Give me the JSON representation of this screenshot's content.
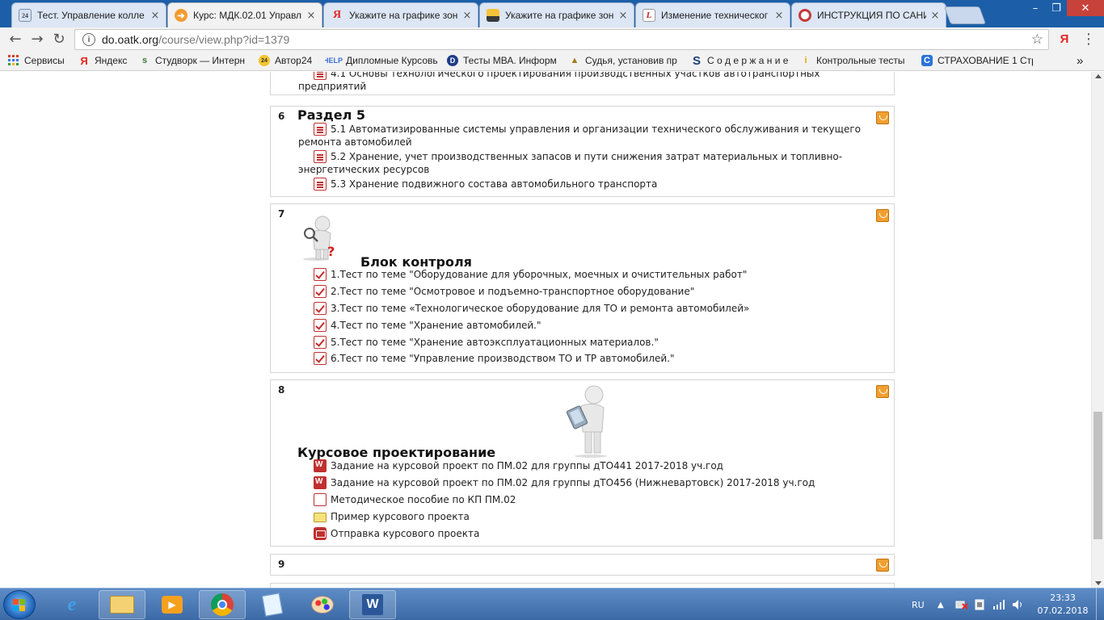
{
  "tabs": [
    {
      "title": "Тест. Управление колле",
      "favicon": "clock-badge-icon",
      "active": false
    },
    {
      "title": "Курс: МДК.02.01 Управл",
      "favicon": "moodle-icon",
      "active": true
    },
    {
      "title": "Укажите на графике зон",
      "favicon": "yandex-icon",
      "active": false
    },
    {
      "title": "Укажите на графике зон",
      "favicon": "image-icon",
      "active": false
    },
    {
      "title": "Изменение техническог",
      "favicon": "l-letter-icon",
      "active": false
    },
    {
      "title": "ИНСТРУКЦИЯ ПО САНИ",
      "favicon": "lifebuoy-icon",
      "active": false
    }
  ],
  "close_glyph": "×",
  "window": {
    "minimize": "–",
    "maximize": "❐",
    "close": "✕"
  },
  "address": {
    "host": "do.oatk.org",
    "path": "/course/view.php?id=1379"
  },
  "toolbar": {
    "back": "←",
    "forward": "→",
    "reload": "↻",
    "info": "i",
    "star": "☆",
    "yandex": "Я",
    "menu": "⋮"
  },
  "bookmarks": [
    {
      "label": "Сервисы",
      "icon": "apps-grid-icon"
    },
    {
      "label": "Яндекс",
      "icon": "yandex-icon"
    },
    {
      "label": "Студворк — Интерн",
      "icon": "studwork-icon"
    },
    {
      "label": "Автор24",
      "icon": "author24-icon"
    },
    {
      "label": "Дипломные Курсовь",
      "icon": "help-icon"
    },
    {
      "label": "Тесты МВА. Информ",
      "icon": "d-circle-icon"
    },
    {
      "label": "Судья, установив пр",
      "icon": "triangle-icon"
    },
    {
      "label": "С о д е р ж а н и е",
      "icon": "s-letter-icon"
    },
    {
      "label": "Контрольные тесты",
      "icon": "i-letter-icon"
    },
    {
      "label": "СТРАХОВАНИЕ 1 Стр",
      "icon": "c-letter-icon"
    }
  ],
  "bookmarks_more": "»",
  "course": {
    "top_fragment": {
      "line1": "4.1 Основы технологического проектирования производственных участков автотранспортных",
      "line2": "предприятий"
    },
    "section6": {
      "number": "6",
      "title": "Раздел 5",
      "items": [
        {
          "text": "5.1 Автоматизированные системы управления и организации технического обслуживания и текущего ремонта автомобилей",
          "icon": "page-icon"
        },
        {
          "text": "5.2 Хранение, учет производственных запасов и пути снижения затрат материальных и топливно-энергетических ресурсов",
          "icon": "page-icon"
        },
        {
          "text": "5.3 Хранение подвижного состава автомобильного транспорта",
          "icon": "page-icon"
        }
      ]
    },
    "section7": {
      "number": "7",
      "title": "Блок контроля",
      "items": [
        {
          "text": "1.Тест по теме \"Оборудование для уборочных, моечных и очистительных работ\"",
          "icon": "quiz-icon"
        },
        {
          "text": "2.Тест по теме \"Осмотровое и подъемно-транспортное оборудование\"",
          "icon": "quiz-icon"
        },
        {
          "text": "3.Тест по теме «Технологическое оборудование для ТО и ремонта автомобилей»",
          "icon": "quiz-icon"
        },
        {
          "text": "4.Тест по теме \"Хранение автомобилей.\"",
          "icon": "quiz-icon"
        },
        {
          "text": "5.Тест по теме \"Хранение автоэксплуатационных материалов.\"",
          "icon": "quiz-icon"
        },
        {
          "text": "6.Тест по теме \"Управление производством ТО и ТР автомобилей.\"",
          "icon": "quiz-icon"
        }
      ]
    },
    "section8": {
      "number": "8",
      "title": "Курсовое проектирование",
      "items": [
        {
          "text": "Задание на курсовой проект по ПМ.02 для группы дТО441 2017-2018 уч.год",
          "icon": "word-icon"
        },
        {
          "text": "Задание на курсовой проект по ПМ.02 для группы дТО456 (Нижневартовск) 2017-2018 уч.год",
          "icon": "word-icon"
        },
        {
          "text": "Методическое пособие по КП ПМ.02",
          "icon": "file-icon"
        },
        {
          "text": "Пример курсового проекта",
          "icon": "folder-icon"
        },
        {
          "text": "Отправка курсового проекта",
          "icon": "assignment-icon"
        }
      ]
    },
    "section9": {
      "number": "9"
    }
  },
  "taskbar": {
    "apps": [
      "explorer-icon",
      "ie-icon",
      "media-player-icon",
      "chrome-icon",
      "notepad-icon",
      "paint-icon",
      "word-icon"
    ],
    "lang": "RU",
    "time": "23:33",
    "date": "07.02.2018"
  },
  "colors": {
    "titlebar": "#1c5fa8",
    "icon_red": "#c03030",
    "highlight": "#f0a030",
    "taskbar": "#3c6aa6"
  }
}
